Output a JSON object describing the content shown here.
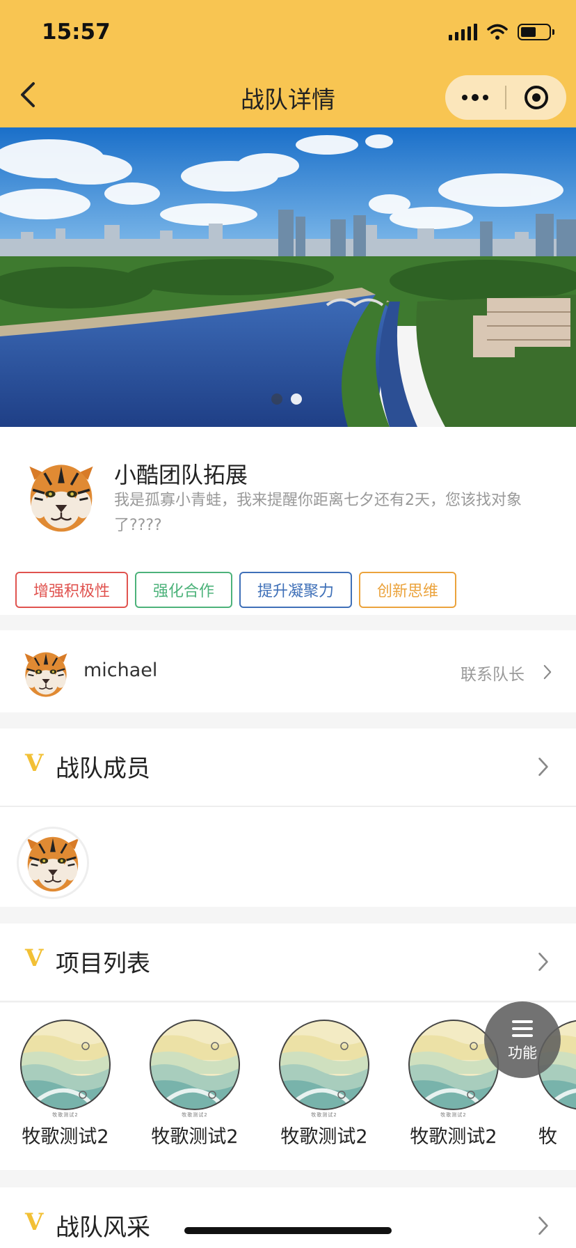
{
  "status_bar": {
    "time": "15:57",
    "battery_level": 0.55
  },
  "nav": {
    "title": "战队详情"
  },
  "banner": {
    "active_slide": 1,
    "slides_count": 2
  },
  "team": {
    "name": "小酷团队拓展",
    "description": "我是孤寡小青蛙，我来提醒你距离七夕还有2天，您该找对象了????",
    "tags": [
      {
        "label": "增强积极性",
        "color": "#e0534f"
      },
      {
        "label": "强化合作",
        "color": "#4cb27a"
      },
      {
        "label": "提升凝聚力",
        "color": "#3f70b8"
      },
      {
        "label": "创新思维",
        "color": "#eba33c"
      }
    ]
  },
  "leader": {
    "name": "michael",
    "contact_label": "联系队长"
  },
  "sections": {
    "members_title": "战队成员",
    "projects_title": "项目列表",
    "style_title": "战队风采"
  },
  "projects": [
    {
      "name": "牧歌测试2",
      "caption": "牧歌测试2"
    },
    {
      "name": "牧歌测试2",
      "caption": "牧歌测试2"
    },
    {
      "name": "牧歌测试2",
      "caption": "牧歌测试2"
    },
    {
      "name": "牧歌测试2",
      "caption": "牧歌测试2"
    },
    {
      "name": "牧",
      "caption": "牧"
    }
  ],
  "fab": {
    "label": "功能"
  },
  "colors": {
    "accent": "#f8c552",
    "v_mark": "#f2c035"
  },
  "icons": [
    "back-icon",
    "more-icon",
    "target-icon",
    "chevron-right-icon",
    "menu-icon",
    "tiger-avatar",
    "landscape-thumb"
  ]
}
